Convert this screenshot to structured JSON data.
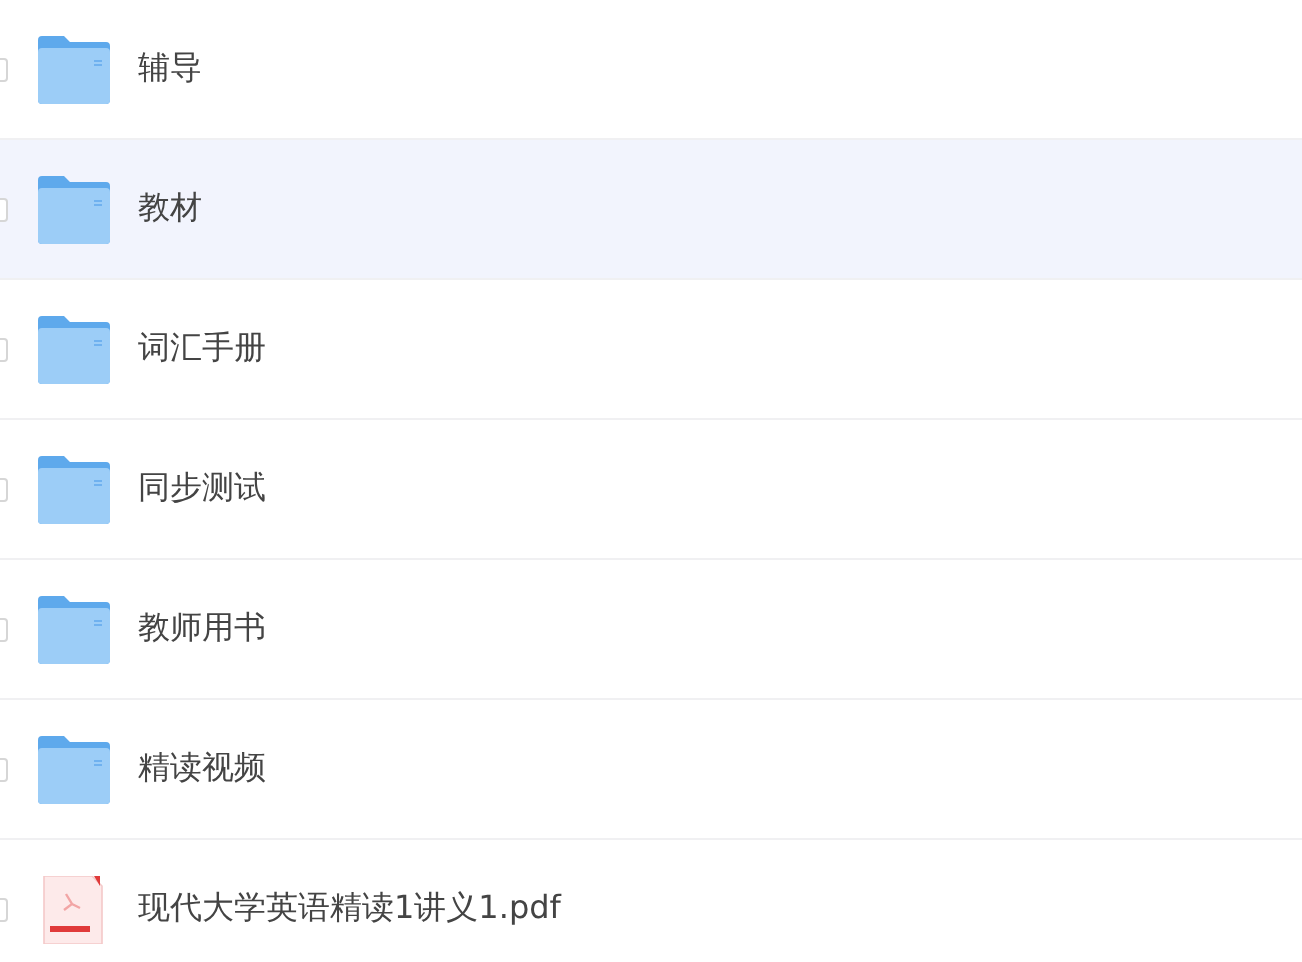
{
  "files": [
    {
      "kind": "folder",
      "name": "辅导",
      "checked": false,
      "highlighted": false
    },
    {
      "kind": "folder",
      "name": "教材",
      "checked": false,
      "highlighted": true
    },
    {
      "kind": "folder",
      "name": "词汇手册",
      "checked": false,
      "highlighted": false
    },
    {
      "kind": "folder",
      "name": "同步测试",
      "checked": false,
      "highlighted": false
    },
    {
      "kind": "folder",
      "name": "教师用书",
      "checked": false,
      "highlighted": false
    },
    {
      "kind": "folder",
      "name": "精读视频",
      "checked": false,
      "highlighted": false
    },
    {
      "kind": "pdf",
      "name": "现代大学英语精读1讲义1.pdf",
      "checked": false,
      "highlighted": false
    }
  ]
}
